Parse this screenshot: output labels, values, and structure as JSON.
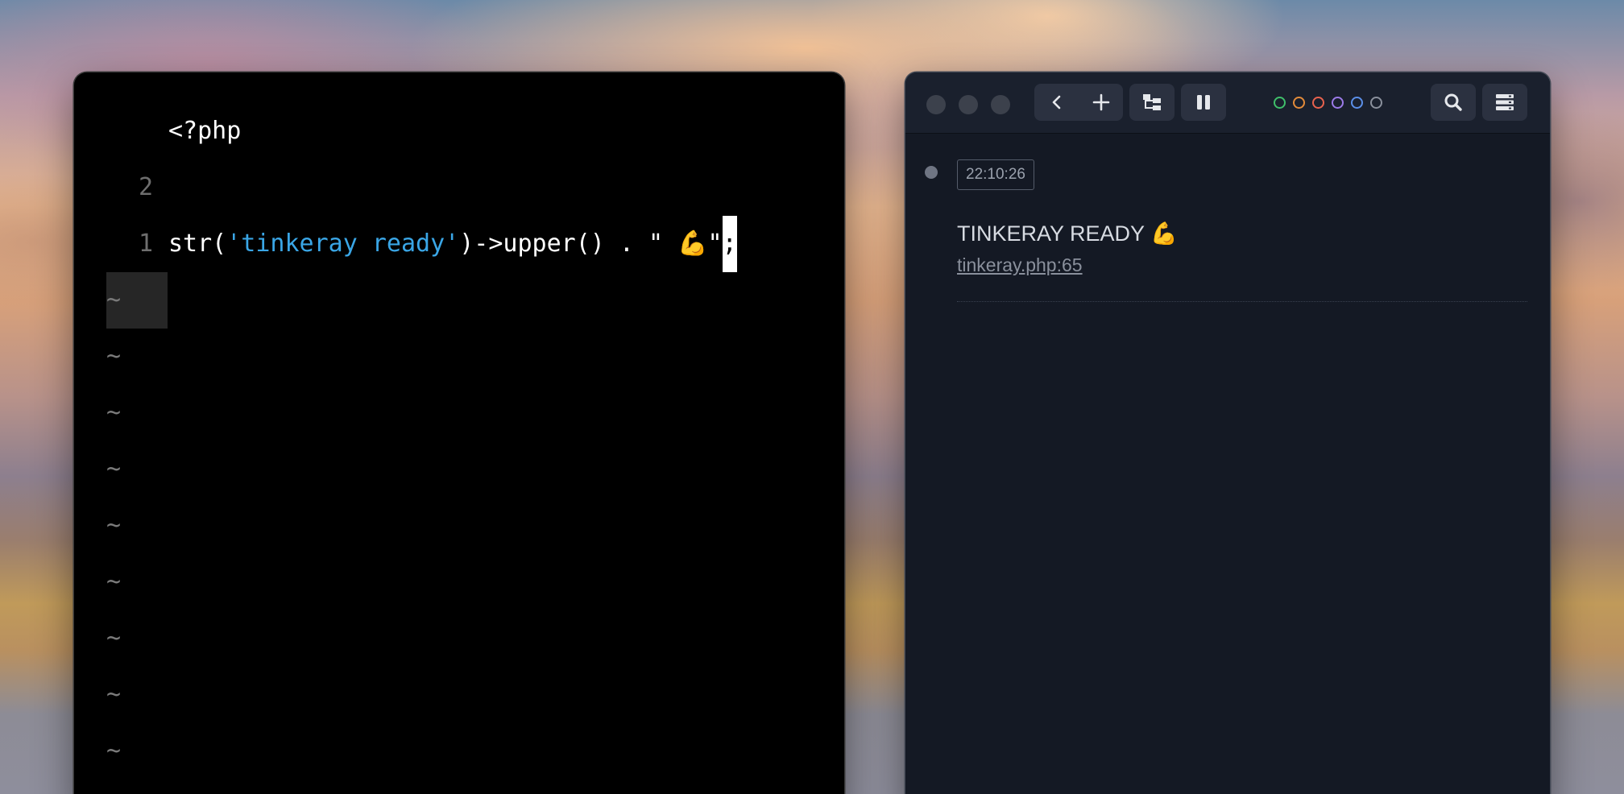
{
  "editor": {
    "lines": [
      {
        "number": "2",
        "text": "<?php"
      },
      {
        "number": "1",
        "text": ""
      },
      {
        "number": "",
        "code_prefix": "str(",
        "code_string": "'tinkeray ready'",
        "code_suffix": ")->upper() . \" 💪\"",
        "code_cursor": ";"
      }
    ],
    "empty_line_marker": "~",
    "colors": {
      "background": "#000000",
      "text": "#ffffff",
      "string": "#3aa6e6",
      "line_number": "#6e6e6e"
    }
  },
  "ray": {
    "toolbar": {
      "icons": [
        "back-icon",
        "plus-icon",
        "hierarchy-icon",
        "pause-icon",
        "search-icon",
        "server-icon"
      ],
      "color_filters": [
        {
          "name": "green",
          "color": "#3fbf6a"
        },
        {
          "name": "orange",
          "color": "#e38b3a"
        },
        {
          "name": "red",
          "color": "#e8624e"
        },
        {
          "name": "purple",
          "color": "#9b7ae8"
        },
        {
          "name": "blue",
          "color": "#5b8fe8"
        },
        {
          "name": "gray",
          "color": "#8a909c"
        }
      ]
    },
    "entries": [
      {
        "time": "22:10:26",
        "output": "TINKERAY READY 💪",
        "origin": "tinkeray.php:65"
      }
    ],
    "colors": {
      "background": "#141924",
      "toolbar": "#1a202d"
    }
  }
}
